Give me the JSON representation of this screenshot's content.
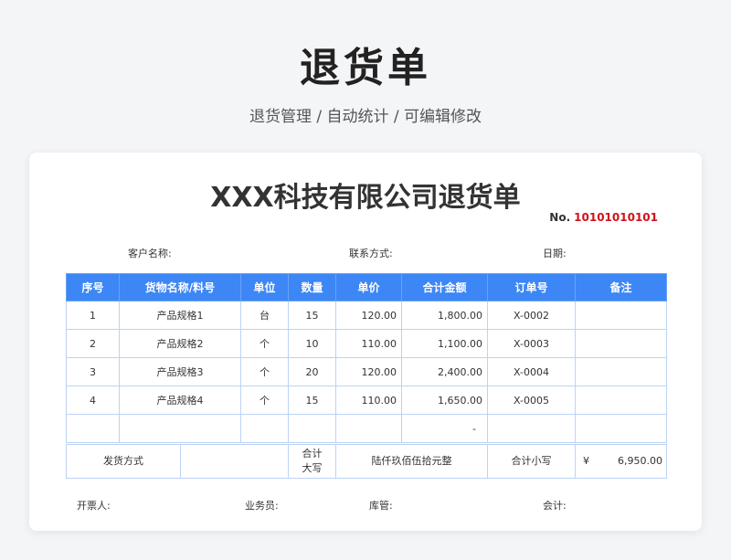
{
  "header": {
    "title": "退货单",
    "subtitle": "退货管理 / 自动统计 /  可编辑修改"
  },
  "document": {
    "company_title": "XXX科技有限公司退货单",
    "no_label": "No.",
    "no_value": "10101010101",
    "customer_label": "客户名称:",
    "contact_label": "联系方式:",
    "date_label": "日期:"
  },
  "table": {
    "columns": [
      "序号",
      "货物名称/料号",
      "单位",
      "数量",
      "单价",
      "合计金额",
      "订单号",
      "备注"
    ],
    "rows": [
      {
        "seq": "1",
        "name": "产品规格1",
        "unit": "台",
        "qty": "15",
        "price": "120.00",
        "amount": "1,800.00",
        "order": "X-0002",
        "note": ""
      },
      {
        "seq": "2",
        "name": "产品规格2",
        "unit": "个",
        "qty": "10",
        "price": "110.00",
        "amount": "1,100.00",
        "order": "X-0003",
        "note": ""
      },
      {
        "seq": "3",
        "name": "产品规格3",
        "unit": "个",
        "qty": "20",
        "price": "120.00",
        "amount": "2,400.00",
        "order": "X-0004",
        "note": ""
      },
      {
        "seq": "4",
        "name": "产品规格4",
        "unit": "个",
        "qty": "15",
        "price": "110.00",
        "amount": "1,650.00",
        "order": "X-0005",
        "note": ""
      }
    ],
    "empty_row_amount": "-"
  },
  "summary": {
    "shipping_label": "发货方式",
    "total_upper_label_line1": "合计",
    "total_upper_label_line2": "大写",
    "total_upper_value": "陆仟玖佰伍拾元整",
    "total_lower_label": "合计小写",
    "currency_symbol": "¥",
    "total_lower_value": "6,950.00"
  },
  "signatures": {
    "issuer": "开票人:",
    "salesperson": "业务员:",
    "warehouse": "库管:",
    "accountant": "会计:"
  },
  "colors": {
    "header_bg": "#3d86f5",
    "doc_no": "#d0121b"
  }
}
